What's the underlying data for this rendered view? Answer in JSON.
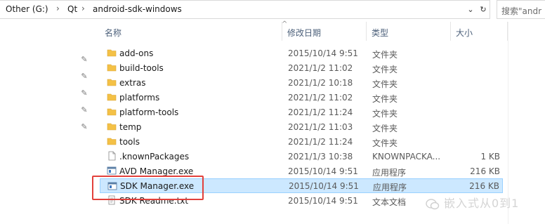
{
  "breadcrumb": [
    "Other (G:)",
    "Qt",
    "android-sdk-windows"
  ],
  "search_placeholder": "搜索\"andr",
  "columns": {
    "name": "名称",
    "date": "修改日期",
    "type": "类型",
    "size": "大小"
  },
  "files": [
    {
      "name": "add-ons",
      "date": "2015/10/14 9:51",
      "type": "文件夹",
      "size": "",
      "icon": "folder-icon"
    },
    {
      "name": "build-tools",
      "date": "2021/1/2 11:02",
      "type": "文件夹",
      "size": "",
      "icon": "folder-icon"
    },
    {
      "name": "extras",
      "date": "2021/1/2 10:18",
      "type": "文件夹",
      "size": "",
      "icon": "folder-icon"
    },
    {
      "name": "platforms",
      "date": "2021/1/2 11:02",
      "type": "文件夹",
      "size": "",
      "icon": "folder-icon"
    },
    {
      "name": "platform-tools",
      "date": "2021/1/2 11:24",
      "type": "文件夹",
      "size": "",
      "icon": "folder-icon"
    },
    {
      "name": "temp",
      "date": "2021/1/2 11:03",
      "type": "文件夹",
      "size": "",
      "icon": "folder-icon"
    },
    {
      "name": "tools",
      "date": "2021/1/2 11:24",
      "type": "文件夹",
      "size": "",
      "icon": "folder-icon"
    },
    {
      "name": ".knownPackages",
      "date": "2021/1/3 10:38",
      "type": "KNOWNPACKA...",
      "size": "1 KB",
      "icon": "file-icon"
    },
    {
      "name": "AVD Manager.exe",
      "date": "2015/10/14 9:51",
      "type": "应用程序",
      "size": "216 KB",
      "icon": "exe-icon"
    },
    {
      "name": "SDK Manager.exe",
      "date": "2015/10/14 9:51",
      "type": "应用程序",
      "size": "216 KB",
      "icon": "exe-icon",
      "selected": true
    },
    {
      "name": "SDK Readme.txt",
      "date": "2015/10/14 9:51",
      "type": "文本文档",
      "size": "",
      "icon": "text-file-icon"
    }
  ],
  "watermark": "嵌入式从0到1",
  "colors": {
    "selection_bg": "#cce8ff",
    "selection_border": "#99d1ff",
    "highlight_box": "#e2403b",
    "folder": "#f4c146"
  }
}
